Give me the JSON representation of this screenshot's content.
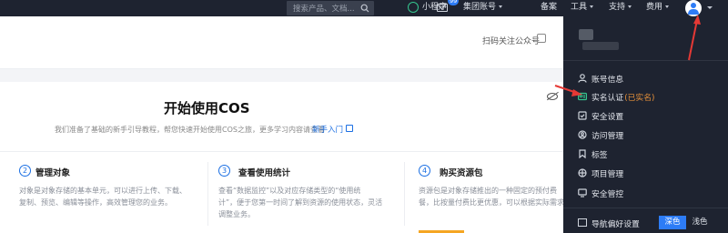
{
  "topbar": {
    "search_placeholder": "搜索产品、文档...",
    "mini_program": "小程序",
    "mail_badge": "99",
    "group_account": "集团账号",
    "beian": "备案",
    "tools": "工具",
    "support": "支持",
    "billing": "费用"
  },
  "header": {
    "follow_official": "扫码关注公众号"
  },
  "main": {
    "title": "开始使用COS",
    "description": "我们准备了基础的新手引导教程，帮您快速开始使用COS之旅，更多学习内容请查看",
    "guide_link": "新手入门"
  },
  "cards": [
    {
      "num": "2",
      "title": "管理对象",
      "desc1": "对象是对象存储的基本单元，可以进行上传、下载、",
      "desc2": "复制、预览、编辑等操作，高效管理您的业务。"
    },
    {
      "num": "3",
      "title": "查看使用统计",
      "desc1": "查看“数据监控”以及对应存储类型的“使用统",
      "desc2": "计”，便于您第一时间了解到资源的使用状态，灵活",
      "desc3": "调整业务。"
    },
    {
      "num": "4",
      "title": "购买资源包",
      "desc1": "资源包是对象存储推出的一种固定的预付费",
      "desc2": "餐，比按量付费比更优惠，可以根据实际需求"
    }
  ],
  "account_menu": {
    "items": [
      {
        "label": "账号信息",
        "icon": "user-icon"
      },
      {
        "label": "实名认证",
        "suffix": "(已实名)",
        "icon": "id-verify-icon"
      },
      {
        "label": "安全设置",
        "icon": "shield-icon"
      },
      {
        "label": "访问管理",
        "icon": "access-icon"
      },
      {
        "label": "标签",
        "icon": "tag-icon"
      },
      {
        "label": "项目管理",
        "icon": "project-icon"
      },
      {
        "label": "安全管控",
        "icon": "monitor-icon"
      }
    ],
    "nav_pref": "导航偏好设置",
    "theme_dark": "深色",
    "theme_light": "浅色"
  },
  "colors": {
    "topbar_bg": "#1e2330",
    "accent": "#2d7cf6",
    "link": "#1b6fe3",
    "verified": "#e8923a",
    "annotation": "#e53935"
  }
}
